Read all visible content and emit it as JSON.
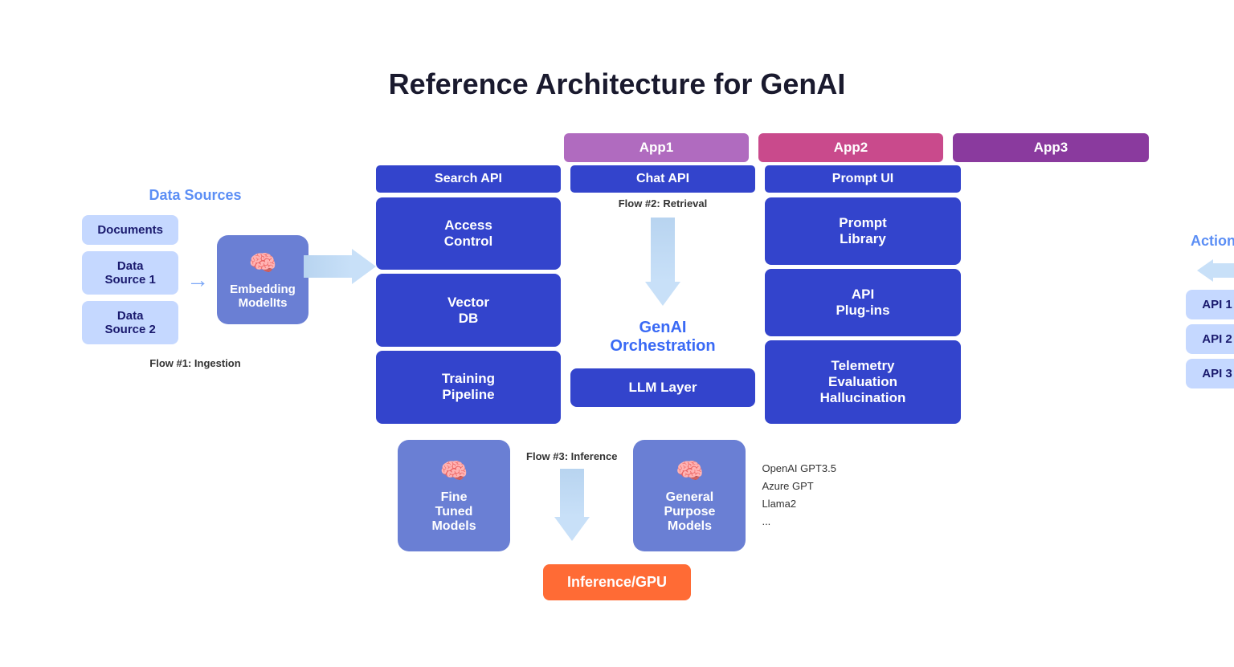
{
  "title": "Reference Architecture for GenAI",
  "left": {
    "section_title": "Data Sources",
    "data_sources": [
      "Documents",
      "Data Source 1",
      "Data Source 2"
    ],
    "embedding_label": "Embedding ModelIts",
    "flow1_label": "Flow #1: Ingestion"
  },
  "apps": [
    {
      "label": "App1"
    },
    {
      "label": "App2"
    },
    {
      "label": "App3"
    }
  ],
  "apis": [
    {
      "label": "Search API"
    },
    {
      "label": "Chat API"
    },
    {
      "label": "Prompt UI"
    }
  ],
  "search_col": [
    {
      "label": "Access\nControl"
    },
    {
      "label": "Vector\nDB"
    },
    {
      "label": "Training\nPipeline"
    }
  ],
  "chat_col": {
    "flow2_label": "Flow #2: Retrieval",
    "genai_label": "GenAI\nOrchestration",
    "llm_label": "LLM Layer"
  },
  "prompt_col": [
    {
      "label": "Prompt\nLibrary"
    },
    {
      "label": "API\nPlug-ins"
    },
    {
      "label": "Telemetry\nEvaluation\nHallucination"
    }
  ],
  "right": {
    "actions_title": "Actions",
    "apis": [
      "API 1",
      "API 2",
      "API 3"
    ]
  },
  "bottom": {
    "flow3_label": "Flow #3: Inference",
    "fine_tuned_label": "Fine\nTuned\nModels",
    "general_label": "General\nPurpose\nModels",
    "models_list": "OpenAI GPT3.5\nAzure GPT\nLlama2\n...",
    "inference_label": "Inference/GPU"
  }
}
